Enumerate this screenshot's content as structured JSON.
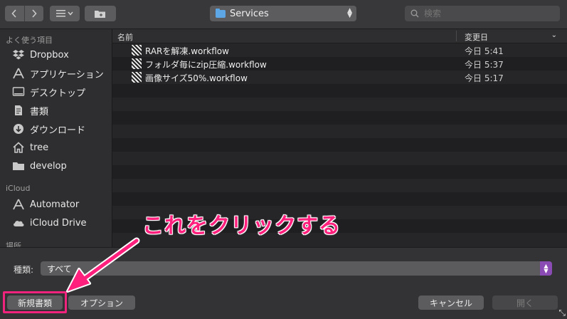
{
  "toolbar": {
    "back_icon": "chevron-left-icon",
    "forward_icon": "chevron-right-icon",
    "view_icon": "list-view-icon",
    "new_folder_icon": "new-folder-icon",
    "location": "Services",
    "search_placeholder": "検索"
  },
  "sidebar": {
    "favorites_header": "よく使う項目",
    "favorites": [
      {
        "label": "Dropbox",
        "icon": "dropbox-icon"
      },
      {
        "label": "アプリケーション",
        "icon": "applications-icon"
      },
      {
        "label": "デスクトップ",
        "icon": "desktop-icon"
      },
      {
        "label": "書類",
        "icon": "documents-icon"
      },
      {
        "label": "ダウンロード",
        "icon": "downloads-icon"
      },
      {
        "label": "tree",
        "icon": "home-icon"
      },
      {
        "label": "develop",
        "icon": "folder-icon"
      }
    ],
    "icloud_header": "iCloud",
    "icloud": [
      {
        "label": "Automator",
        "icon": "automator-icon"
      },
      {
        "label": "iCloud Drive",
        "icon": "cloud-icon"
      }
    ],
    "locations_header": "場所"
  },
  "file_list": {
    "columns": {
      "name": "名前",
      "date": "変更日"
    },
    "files": [
      {
        "name": "RARを解凍.workflow",
        "date": "今日 5:41"
      },
      {
        "name": "フォルダ毎にzip圧縮.workflow",
        "date": "今日 5:37"
      },
      {
        "name": "画像サイズ50%.workflow",
        "date": "今日 5:17"
      }
    ]
  },
  "bottom": {
    "kind_label": "種類:",
    "kind_value": "すべて",
    "new_document": "新規書類",
    "options": "オプション",
    "cancel": "キャンセル",
    "open": "開く"
  },
  "annotation": {
    "text": "これをクリックする",
    "color": "#ff1f7c"
  }
}
